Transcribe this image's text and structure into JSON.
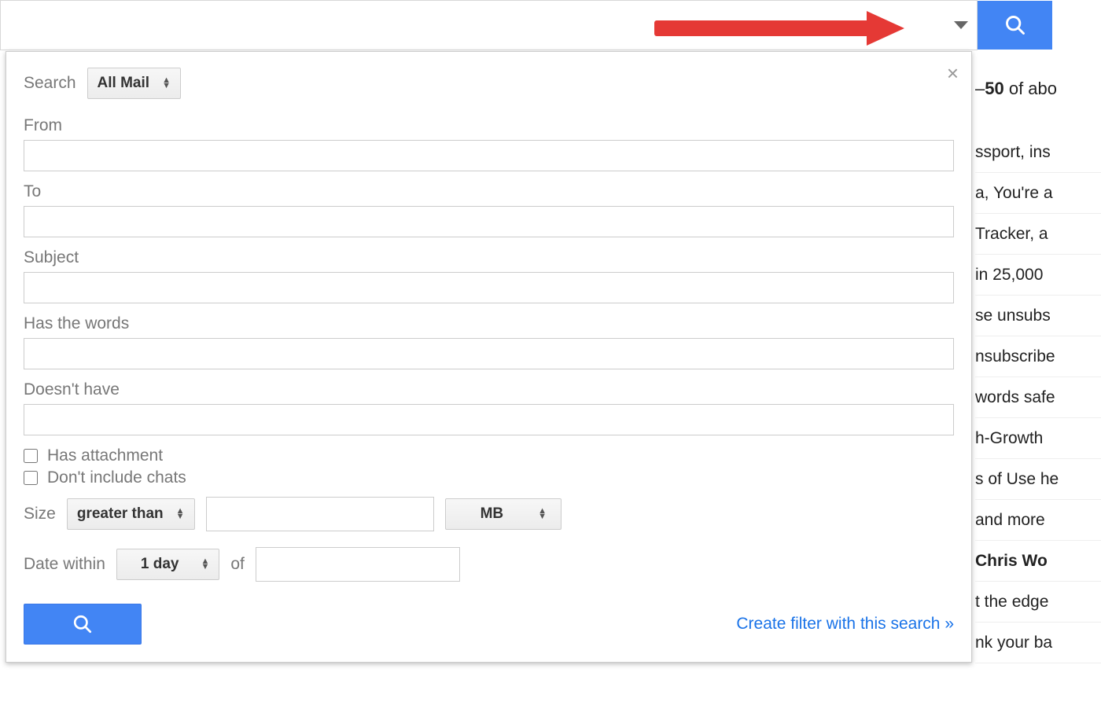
{
  "topBar": {
    "dropdownIconName": "caret-down-icon",
    "searchButtonIconName": "search-icon"
  },
  "panel": {
    "closeLabel": "×",
    "searchScope": {
      "label": "Search",
      "value": "All Mail"
    },
    "fields": {
      "from": {
        "label": "From",
        "value": ""
      },
      "to": {
        "label": "To",
        "value": ""
      },
      "subject": {
        "label": "Subject",
        "value": ""
      },
      "hasWords": {
        "label": "Has the words",
        "value": ""
      },
      "doesntHave": {
        "label": "Doesn't have",
        "value": ""
      }
    },
    "checkboxes": {
      "hasAttachment": {
        "label": "Has attachment",
        "checked": false
      },
      "dontIncludeChats": {
        "label": "Don't include chats",
        "checked": false
      }
    },
    "size": {
      "label": "Size",
      "comparator": "greater than",
      "value": "",
      "unit": "MB"
    },
    "date": {
      "label": "Date within",
      "range": "1 day",
      "ofLabel": "of",
      "value": ""
    },
    "createFilterLink": "Create filter with this search »"
  },
  "background": {
    "header_prefix": "–",
    "header_bold": "50",
    "header_suffix": " of abo",
    "rows": [
      {
        "text": "ssport, ins",
        "bold": false
      },
      {
        "text": "a, You're a",
        "bold": false
      },
      {
        "text": " Tracker, a",
        "bold": false
      },
      {
        "text": "in 25,000 ",
        "bold": false
      },
      {
        "text": "se unsubs",
        "bold": false
      },
      {
        "text": "nsubscribe",
        "bold": false
      },
      {
        "text": "words safe",
        "bold": false
      },
      {
        "text": "h-Growth",
        "bold": false
      },
      {
        "text": "s of Use he",
        "bold": false
      },
      {
        "text": " and more",
        "bold": false
      },
      {
        "text": " Chris Wo",
        "bold": true
      },
      {
        "text": "t the edge",
        "bold": false
      },
      {
        "text": "nk your ba",
        "bold": false
      }
    ]
  }
}
